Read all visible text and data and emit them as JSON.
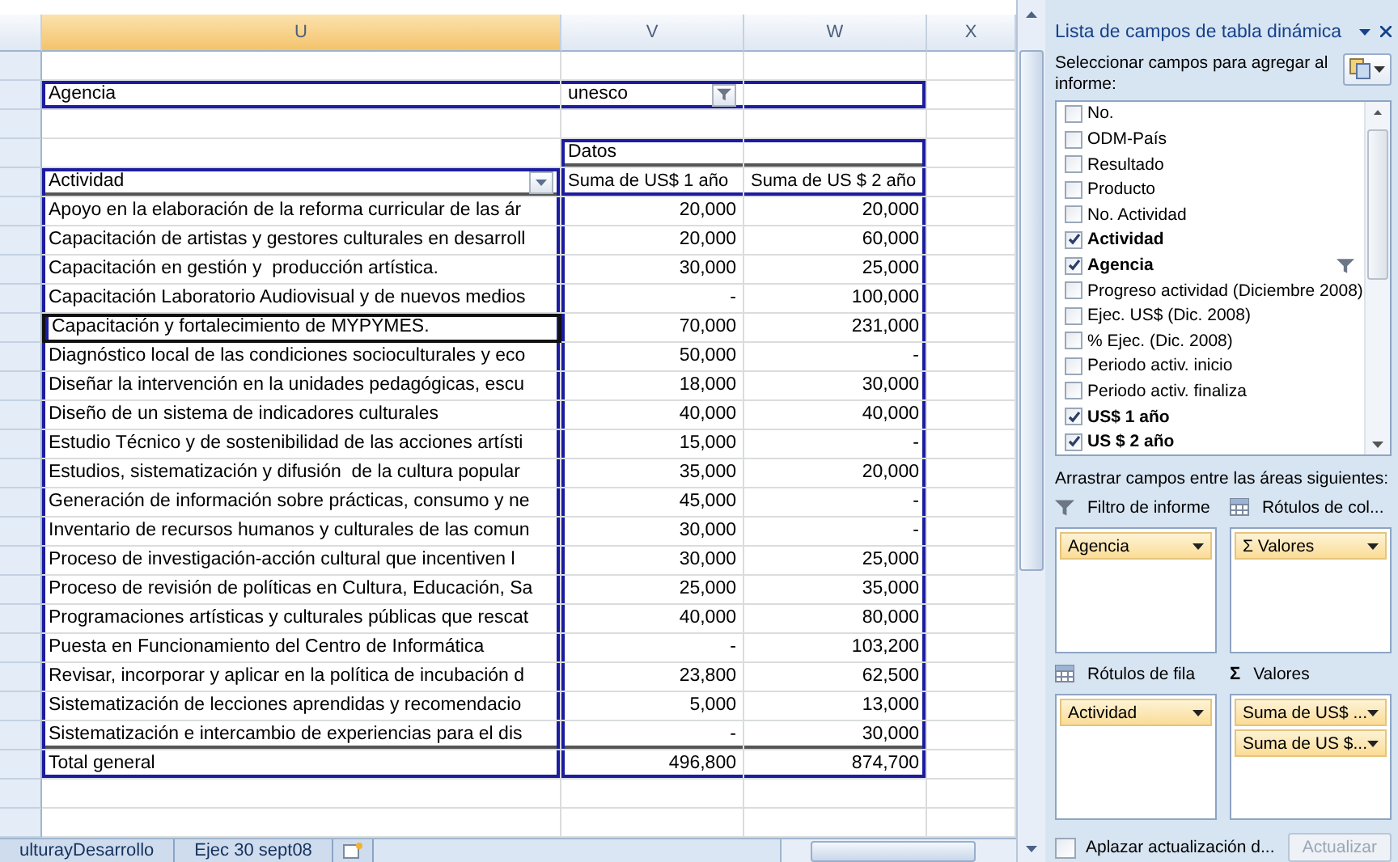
{
  "columns": [
    {
      "label": "U",
      "selected": true
    },
    {
      "label": "V",
      "selected": false
    },
    {
      "label": "W",
      "selected": false
    },
    {
      "label": "X",
      "selected": false
    }
  ],
  "pivot": {
    "filter": {
      "label": "Agencia",
      "value": "unesco"
    },
    "values_caption": "Datos",
    "row_header": "Actividad",
    "value_headers": [
      "Suma de US$ 1 año",
      "Suma de US $ 2 año"
    ],
    "rows": [
      {
        "label": "Apoyo en la elaboración de la reforma curricular de las ár",
        "v1": "20,000",
        "v2": "20,000",
        "selected": false
      },
      {
        "label": "Capacitación de artistas y gestores culturales en desarroll",
        "v1": "20,000",
        "v2": "60,000",
        "selected": false
      },
      {
        "label": "Capacitación en gestión y  producción artística.",
        "v1": "30,000",
        "v2": "25,000",
        "selected": false
      },
      {
        "label": "Capacitación Laboratorio Audiovisual y de nuevos medios",
        "v1": "-",
        "v2": "100,000",
        "selected": false
      },
      {
        "label": "Capacitación y fortalecimiento de MYPYMES.",
        "v1": "70,000",
        "v2": "231,000",
        "selected": true
      },
      {
        "label": "Diagnóstico local de las condiciones socioculturales y eco",
        "v1": "50,000",
        "v2": "-",
        "selected": false
      },
      {
        "label": "Diseñar la intervención en la unidades pedagógicas, escu",
        "v1": "18,000",
        "v2": "30,000",
        "selected": false
      },
      {
        "label": "Diseño de un sistema de indicadores culturales",
        "v1": "40,000",
        "v2": "40,000",
        "selected": false
      },
      {
        "label": "Estudio Técnico y de sostenibilidad de las acciones artísti",
        "v1": "15,000",
        "v2": "-",
        "selected": false
      },
      {
        "label": "Estudios, sistematización y difusión  de la cultura popular",
        "v1": "35,000",
        "v2": "20,000",
        "selected": false
      },
      {
        "label": "Generación de información sobre prácticas, consumo y ne",
        "v1": "45,000",
        "v2": "-",
        "selected": false
      },
      {
        "label": "Inventario de recursos humanos y culturales de las comun",
        "v1": "30,000",
        "v2": "-",
        "selected": false
      },
      {
        "label": "Proceso de investigación-acción cultural que incentiven l",
        "v1": "30,000",
        "v2": "25,000",
        "selected": false
      },
      {
        "label": "Proceso de revisión de políticas en Cultura, Educación, Sa",
        "v1": "25,000",
        "v2": "35,000",
        "selected": false
      },
      {
        "label": "Programaciones artísticas y culturales públicas que rescat",
        "v1": "40,000",
        "v2": "80,000",
        "selected": false
      },
      {
        "label": "Puesta en Funcionamiento del Centro de Informática",
        "v1": "-",
        "v2": "103,200",
        "selected": false
      },
      {
        "label": "Revisar, incorporar y aplicar en la política de incubación d",
        "v1": "23,800",
        "v2": "62,500",
        "selected": false
      },
      {
        "label": "Sistematización de lecciones aprendidas y recomendacio",
        "v1": "5,000",
        "v2": "13,000",
        "selected": false
      },
      {
        "label": "Sistematización e intercambio de experiencias para el dis",
        "v1": "-",
        "v2": "30,000",
        "selected": false
      }
    ],
    "total": {
      "label": "Total general",
      "v1": "496,800",
      "v2": "874,700"
    }
  },
  "sheet_tabs": [
    {
      "label": "ulturayDesarrollo"
    },
    {
      "label": "Ejec 30 sept08"
    }
  ],
  "field_list": {
    "title": "Lista de campos de tabla dinámica",
    "prompt": "Seleccionar campos para agregar al informe:",
    "fields": [
      {
        "label": "No.",
        "checked": false,
        "filtered": false
      },
      {
        "label": "ODM-País",
        "checked": false,
        "filtered": false
      },
      {
        "label": "Resultado",
        "checked": false,
        "filtered": false
      },
      {
        "label": "Producto",
        "checked": false,
        "filtered": false
      },
      {
        "label": "No. Actividad",
        "checked": false,
        "filtered": false
      },
      {
        "label": "Actividad",
        "checked": true,
        "filtered": false
      },
      {
        "label": "Agencia",
        "checked": true,
        "filtered": true
      },
      {
        "label": "Progreso actividad (Diciembre 2008)",
        "checked": false,
        "filtered": false
      },
      {
        "label": "Ejec. US$ (Dic. 2008)",
        "checked": false,
        "filtered": false
      },
      {
        "label": "% Ejec. (Dic. 2008)",
        "checked": false,
        "filtered": false
      },
      {
        "label": "Periodo activ. inicio",
        "checked": false,
        "filtered": false
      },
      {
        "label": "Periodo activ. finaliza",
        "checked": false,
        "filtered": false
      },
      {
        "label": "US$ 1 año",
        "checked": true,
        "filtered": false
      },
      {
        "label": "US $ 2 año",
        "checked": true,
        "filtered": false
      }
    ],
    "areas_prompt": "Arrastrar campos entre las áreas siguientes:",
    "areas": [
      {
        "kind": "filter",
        "title": "Filtro de informe",
        "items": [
          "Agencia"
        ]
      },
      {
        "kind": "grid",
        "title": "Rótulos de col...",
        "items": [
          "Σ Valores"
        ]
      },
      {
        "kind": "grid",
        "title": "Rótulos de fila",
        "items": [
          "Actividad"
        ]
      },
      {
        "kind": "symbol",
        "symbol": "Σ",
        "title": "Valores",
        "items": [
          "Suma de US$ ...",
          "Suma de US $..."
        ]
      }
    ],
    "defer": {
      "label": "Aplazar actualización d...",
      "checked": false
    },
    "update_button": {
      "label": "Actualizar",
      "disabled": true
    }
  }
}
